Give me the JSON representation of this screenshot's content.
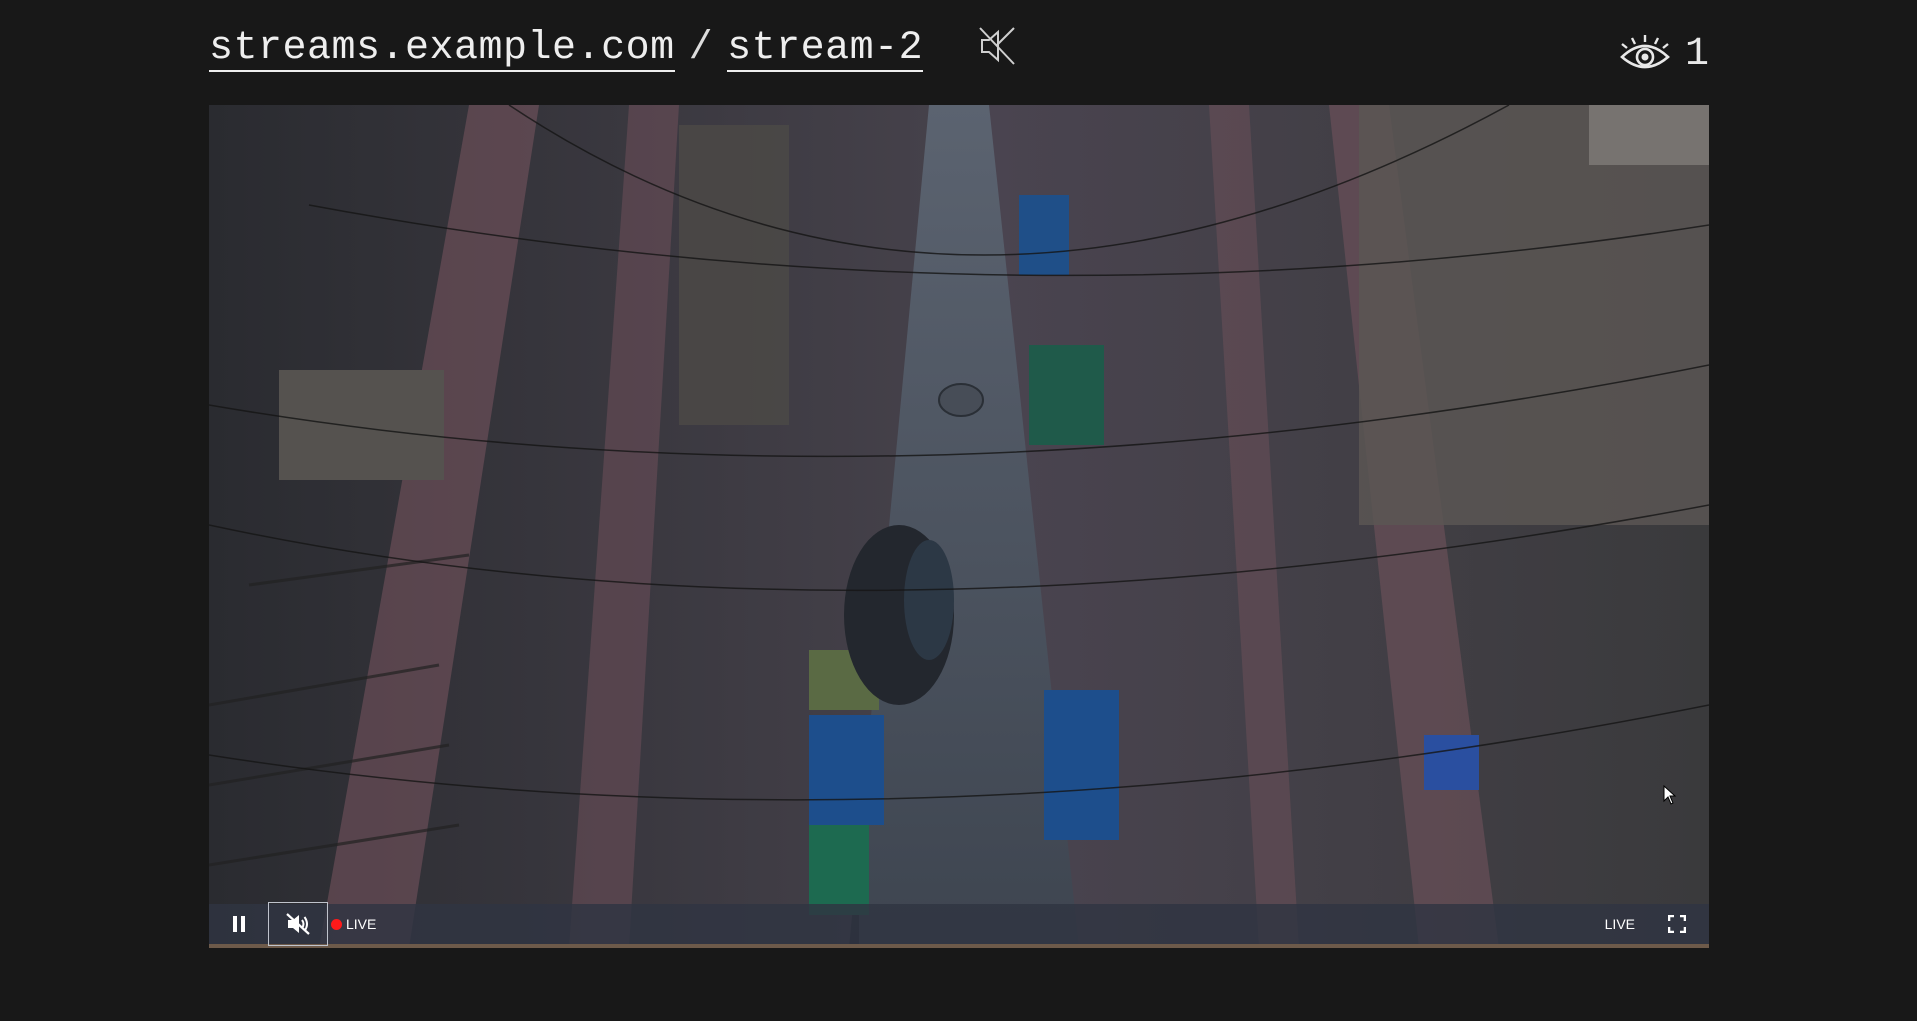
{
  "header": {
    "domain_link": "streams.example.com",
    "separator": "/",
    "stream_link": "stream-2",
    "mute_icon": "speaker-muted-icon",
    "viewer_icon": "eye-icon",
    "viewer_count": "1"
  },
  "player": {
    "play_icon": "pause-icon",
    "mute_icon": "volume-muted-icon",
    "live_indicator": "LIVE",
    "live_dot_color": "#ff1a1a",
    "live_button": "LIVE",
    "fullscreen_icon": "fullscreen-icon"
  },
  "colors": {
    "background": "#181818",
    "text": "#eeeeee",
    "control_bar": "#303442",
    "progress": "#6d5a4a"
  }
}
